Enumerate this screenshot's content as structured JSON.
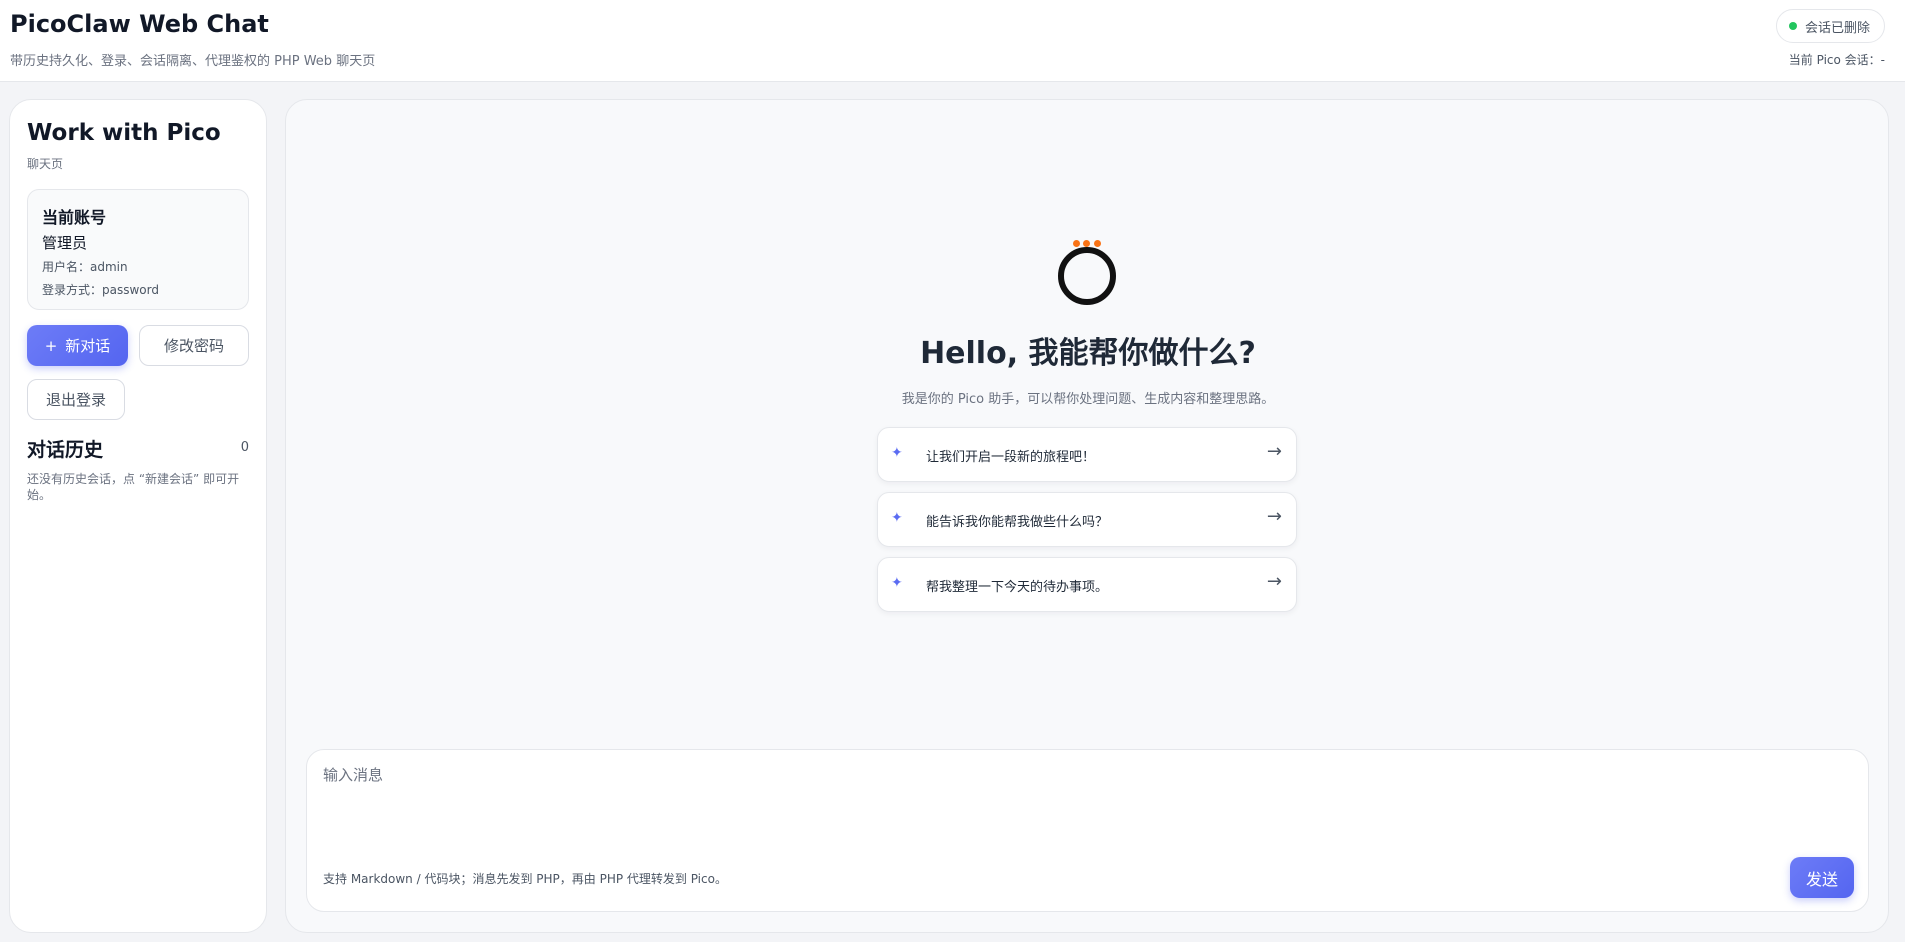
{
  "header": {
    "title": "PicoClaw Web Chat",
    "subtitle": "带历史持久化、登录、会话隔离、代理鉴权的 PHP Web 聊天页",
    "status_label": "会话已删除",
    "status_color": "#22c55e",
    "session_label": "当前 Pico 会话：-"
  },
  "sidebar": {
    "title": "Work with Pico",
    "subtitle": "聊天页",
    "account": {
      "heading": "当前账号",
      "role": "管理员",
      "username_line": "用户名：admin",
      "login_line": "登录方式：password"
    },
    "buttons": {
      "new_chat_icon": "+",
      "new_chat": "新对话",
      "change_password": "修改密码",
      "logout": "退出登录"
    },
    "history": {
      "title": "对话历史",
      "count": "0",
      "empty_text": "还没有历史会话，点 “新建会话” 即可开始。"
    }
  },
  "main": {
    "logo_icon": "pico-ring-logo",
    "greeting": "Hello, 我能帮你做什么?",
    "intro": "我是你的 Pico 助手，可以帮你处理问题、生成内容和整理思路。",
    "suggestions": [
      {
        "star": "✦",
        "text": "让我们开启一段新的旅程吧！",
        "arrow": "→"
      },
      {
        "star": "✦",
        "text": "能告诉我你能帮我做些什么吗？",
        "arrow": "→"
      },
      {
        "star": "✦",
        "text": "帮我整理一下今天的待办事项。",
        "arrow": "→"
      }
    ],
    "composer": {
      "placeholder": "输入消息",
      "value": "",
      "hint": "支持 Markdown / 代码块；消息先发到 PHP，再由 PHP 代理转发到 Pico。",
      "send_label": "发送"
    }
  },
  "colors": {
    "accent": "#5b6cf2",
    "logo_dot": "#f97316"
  }
}
